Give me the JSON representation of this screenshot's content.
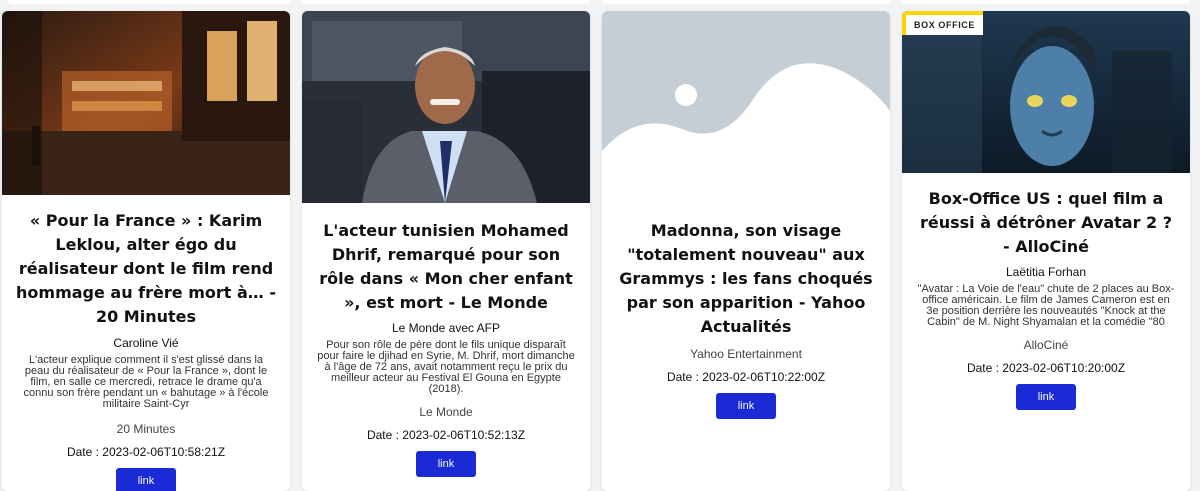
{
  "cards": [
    {
      "title": "« Pour la France » : Karim Leklou, alter égo du réalisateur dont le film rend hommage au frère mort à… - 20 Minutes",
      "author": "Caroline Vié",
      "description": "L'acteur explique comment il s'est glissé dans la peau du réalisateur de « Pour la France », dont le film, en salle ce mercredi, retrace le drame qu'a connu son frère pendant un « bahutage » à l'école militaire Saint-Cyr",
      "source": "20 Minutes",
      "date": "Date : 2023-02-06T10:58:21Z",
      "link_label": "link",
      "image": "street-scene-image"
    },
    {
      "title": "L'acteur tunisien Mohamed Dhrif, remarqué pour son rôle dans « Mon cher enfant », est mort - Le Monde",
      "author": "Le Monde avec AFP",
      "description": "Pour son rôle de père dont le fils unique disparaît pour faire le djihad en Syrie, M. Dhrif, mort dimanche à l'âge de 72 ans, avait notamment reçu le prix du meilleur acteur au Festival El Gouna en Egypte (2018).",
      "source": "Le Monde",
      "date": "Date : 2023-02-06T10:52:13Z",
      "link_label": "link",
      "image": "portrait-image"
    },
    {
      "title": "Madonna, son visage \"totalement nouveau\" aux Grammys : les fans choqués par son apparition - Yahoo Actualités",
      "author": "",
      "description": "",
      "source": "Yahoo Entertainment",
      "date": "Date : 2023-02-06T10:22:00Z",
      "link_label": "link",
      "image": "placeholder-image"
    },
    {
      "title": "Box-Office US : quel film a réussi à détrôner Avatar 2 ? - AlloCiné",
      "author": "Laëtitia Forhan",
      "description": "\"Avatar : La Voie de l'eau\" chute de 2 places au Box-office américain. Le film de James Cameron est en 3e position derrière les nouveautés \"Knock at the Cabin\" de M. Night Shyamalan et la comédie \"80",
      "source": "AlloCiné",
      "date": "Date : 2023-02-06T10:20:00Z",
      "link_label": "link",
      "image": "avatar-image",
      "badge": "BOX OFFICE"
    }
  ],
  "colors": {
    "button": "#1a2bd6",
    "badge_yellow": "#ffd400",
    "page_bg": "#f2f3f5"
  }
}
